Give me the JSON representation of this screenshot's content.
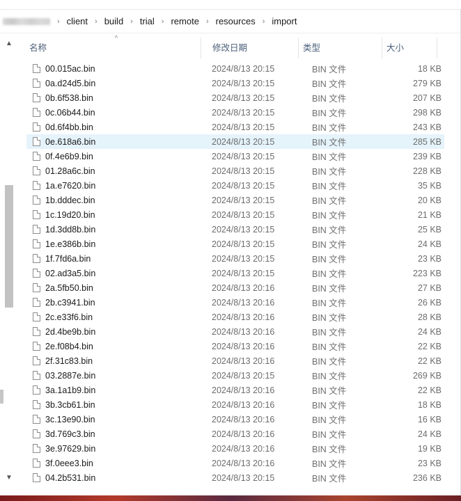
{
  "breadcrumb": {
    "segments": [
      "client",
      "build",
      "trial",
      "remote",
      "resources",
      "import"
    ]
  },
  "columns": {
    "name": "名称",
    "date": "修改日期",
    "type": "类型",
    "size": "大小"
  },
  "icons": {
    "sort": "sort-ascending-caret",
    "file": "generic-file-icon",
    "scroll_up": "chevron-up-icon",
    "scroll_down": "chevron-down-icon"
  },
  "selected_row": 5,
  "files": [
    {
      "name": "00.015ac.bin",
      "date": "2024/8/13 20:15",
      "type": "BIN 文件",
      "size": "18 KB"
    },
    {
      "name": "0a.d24d5.bin",
      "date": "2024/8/13 20:15",
      "type": "BIN 文件",
      "size": "279 KB"
    },
    {
      "name": "0b.6f538.bin",
      "date": "2024/8/13 20:15",
      "type": "BIN 文件",
      "size": "207 KB"
    },
    {
      "name": "0c.06b44.bin",
      "date": "2024/8/13 20:15",
      "type": "BIN 文件",
      "size": "298 KB"
    },
    {
      "name": "0d.6f4bb.bin",
      "date": "2024/8/13 20:15",
      "type": "BIN 文件",
      "size": "243 KB"
    },
    {
      "name": "0e.618a6.bin",
      "date": "2024/8/13 20:15",
      "type": "BIN 文件",
      "size": "285 KB"
    },
    {
      "name": "0f.4e6b9.bin",
      "date": "2024/8/13 20:15",
      "type": "BIN 文件",
      "size": "239 KB"
    },
    {
      "name": "01.28a6c.bin",
      "date": "2024/8/13 20:15",
      "type": "BIN 文件",
      "size": "228 KB"
    },
    {
      "name": "1a.e7620.bin",
      "date": "2024/8/13 20:15",
      "type": "BIN 文件",
      "size": "35 KB"
    },
    {
      "name": "1b.dddec.bin",
      "date": "2024/8/13 20:15",
      "type": "BIN 文件",
      "size": "20 KB"
    },
    {
      "name": "1c.19d20.bin",
      "date": "2024/8/13 20:15",
      "type": "BIN 文件",
      "size": "21 KB"
    },
    {
      "name": "1d.3dd8b.bin",
      "date": "2024/8/13 20:15",
      "type": "BIN 文件",
      "size": "25 KB"
    },
    {
      "name": "1e.e386b.bin",
      "date": "2024/8/13 20:15",
      "type": "BIN 文件",
      "size": "24 KB"
    },
    {
      "name": "1f.7fd6a.bin",
      "date": "2024/8/13 20:15",
      "type": "BIN 文件",
      "size": "23 KB"
    },
    {
      "name": "02.ad3a5.bin",
      "date": "2024/8/13 20:15",
      "type": "BIN 文件",
      "size": "223 KB"
    },
    {
      "name": "2a.5fb50.bin",
      "date": "2024/8/13 20:16",
      "type": "BIN 文件",
      "size": "27 KB"
    },
    {
      "name": "2b.c3941.bin",
      "date": "2024/8/13 20:16",
      "type": "BIN 文件",
      "size": "26 KB"
    },
    {
      "name": "2c.e33f6.bin",
      "date": "2024/8/13 20:16",
      "type": "BIN 文件",
      "size": "28 KB"
    },
    {
      "name": "2d.4be9b.bin",
      "date": "2024/8/13 20:16",
      "type": "BIN 文件",
      "size": "24 KB"
    },
    {
      "name": "2e.f08b4.bin",
      "date": "2024/8/13 20:16",
      "type": "BIN 文件",
      "size": "22 KB"
    },
    {
      "name": "2f.31c83.bin",
      "date": "2024/8/13 20:16",
      "type": "BIN 文件",
      "size": "22 KB"
    },
    {
      "name": "03.2887e.bin",
      "date": "2024/8/13 20:15",
      "type": "BIN 文件",
      "size": "269 KB"
    },
    {
      "name": "3a.1a1b9.bin",
      "date": "2024/8/13 20:16",
      "type": "BIN 文件",
      "size": "22 KB"
    },
    {
      "name": "3b.3cb61.bin",
      "date": "2024/8/13 20:16",
      "type": "BIN 文件",
      "size": "18 KB"
    },
    {
      "name": "3c.13e90.bin",
      "date": "2024/8/13 20:16",
      "type": "BIN 文件",
      "size": "16 KB"
    },
    {
      "name": "3d.769c3.bin",
      "date": "2024/8/13 20:16",
      "type": "BIN 文件",
      "size": "24 KB"
    },
    {
      "name": "3e.97629.bin",
      "date": "2024/8/13 20:16",
      "type": "BIN 文件",
      "size": "19 KB"
    },
    {
      "name": "3f.0eee3.bin",
      "date": "2024/8/13 20:16",
      "type": "BIN 文件",
      "size": "23 KB"
    },
    {
      "name": "04.2b531.bin",
      "date": "2024/8/13 20:15",
      "type": "BIN 文件",
      "size": "236 KB"
    }
  ]
}
